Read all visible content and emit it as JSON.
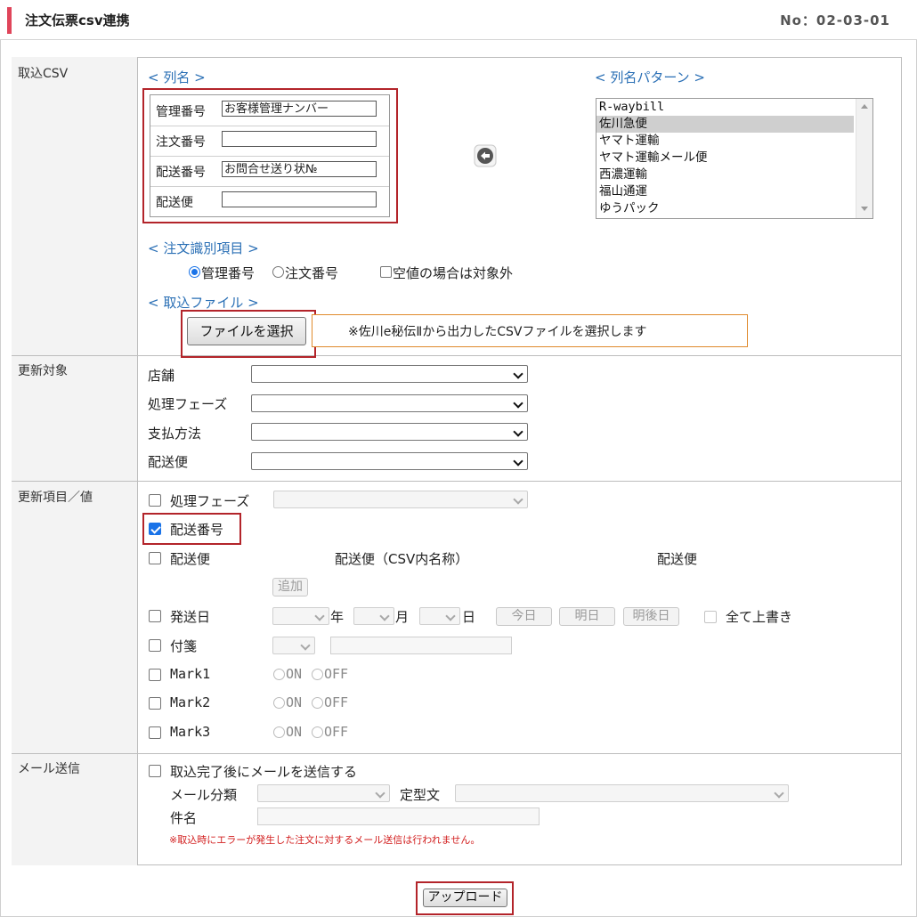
{
  "header": {
    "title": "注文伝票csv連携",
    "page_no": "No：02-03-01"
  },
  "sections": {
    "import_csv": {
      "label": "取込CSV",
      "columns_link": "< 列名 >",
      "columns": [
        {
          "label": "管理番号",
          "value": "お客様管理ナンバー"
        },
        {
          "label": "注文番号",
          "value": ""
        },
        {
          "label": "配送番号",
          "value": "お問合せ送り状№"
        },
        {
          "label": "配送便",
          "value": ""
        }
      ],
      "pattern_link": "< 列名パターン >",
      "patterns": [
        "R-waybill",
        "佐川急便",
        "ヤマト運輸",
        "ヤマト運輸メール便",
        "西濃運輸",
        "福山通運",
        "ゆうパック"
      ],
      "pattern_selected": "佐川急便",
      "order_id_link": "< 注文識別項目 >",
      "radio_mgmt": "管理番号",
      "radio_order": "注文番号",
      "skip_empty": "空値の場合は対象外",
      "file_link": "< 取込ファイル >",
      "file_button": "ファイルを選択",
      "file_note": "※佐川e秘伝Ⅱから出力したCSVファイルを選択します"
    },
    "update_target": {
      "label": "更新対象",
      "fields": [
        "店舗",
        "処理フェーズ",
        "支払方法",
        "配送便"
      ]
    },
    "update_items": {
      "label": "更新項目／値",
      "phase": "処理フェーズ",
      "delivery_no": "配送番号",
      "carrier": "配送便",
      "carrier_csv_name": "配送便（CSV内名称）",
      "carrier_col": "配送便",
      "add": "追加",
      "ship_date": "発送日",
      "year": "年",
      "month": "月",
      "day": "日",
      "today": "今日",
      "tomorrow": "明日",
      "day_after": "明後日",
      "overwrite_all": "全て上書き",
      "tag": "付箋",
      "marks": [
        "Mark1",
        "Mark2",
        "Mark3"
      ],
      "on": "ON",
      "off": "OFF"
    },
    "mail": {
      "label": "メール送信",
      "send_after": "取込完了後にメールを送信する",
      "category": "メール分類",
      "template": "定型文",
      "subject": "件名",
      "warning": "※取込時にエラーが発生した注文に対するメール送信は行われません。"
    }
  },
  "upload_button": "アップロード",
  "colors": {
    "accent": "#e0455a",
    "highlight_box": "#b3242a",
    "note_box": "#e08a2c",
    "link": "#2a6fb5",
    "warning": "#d21e1e"
  }
}
